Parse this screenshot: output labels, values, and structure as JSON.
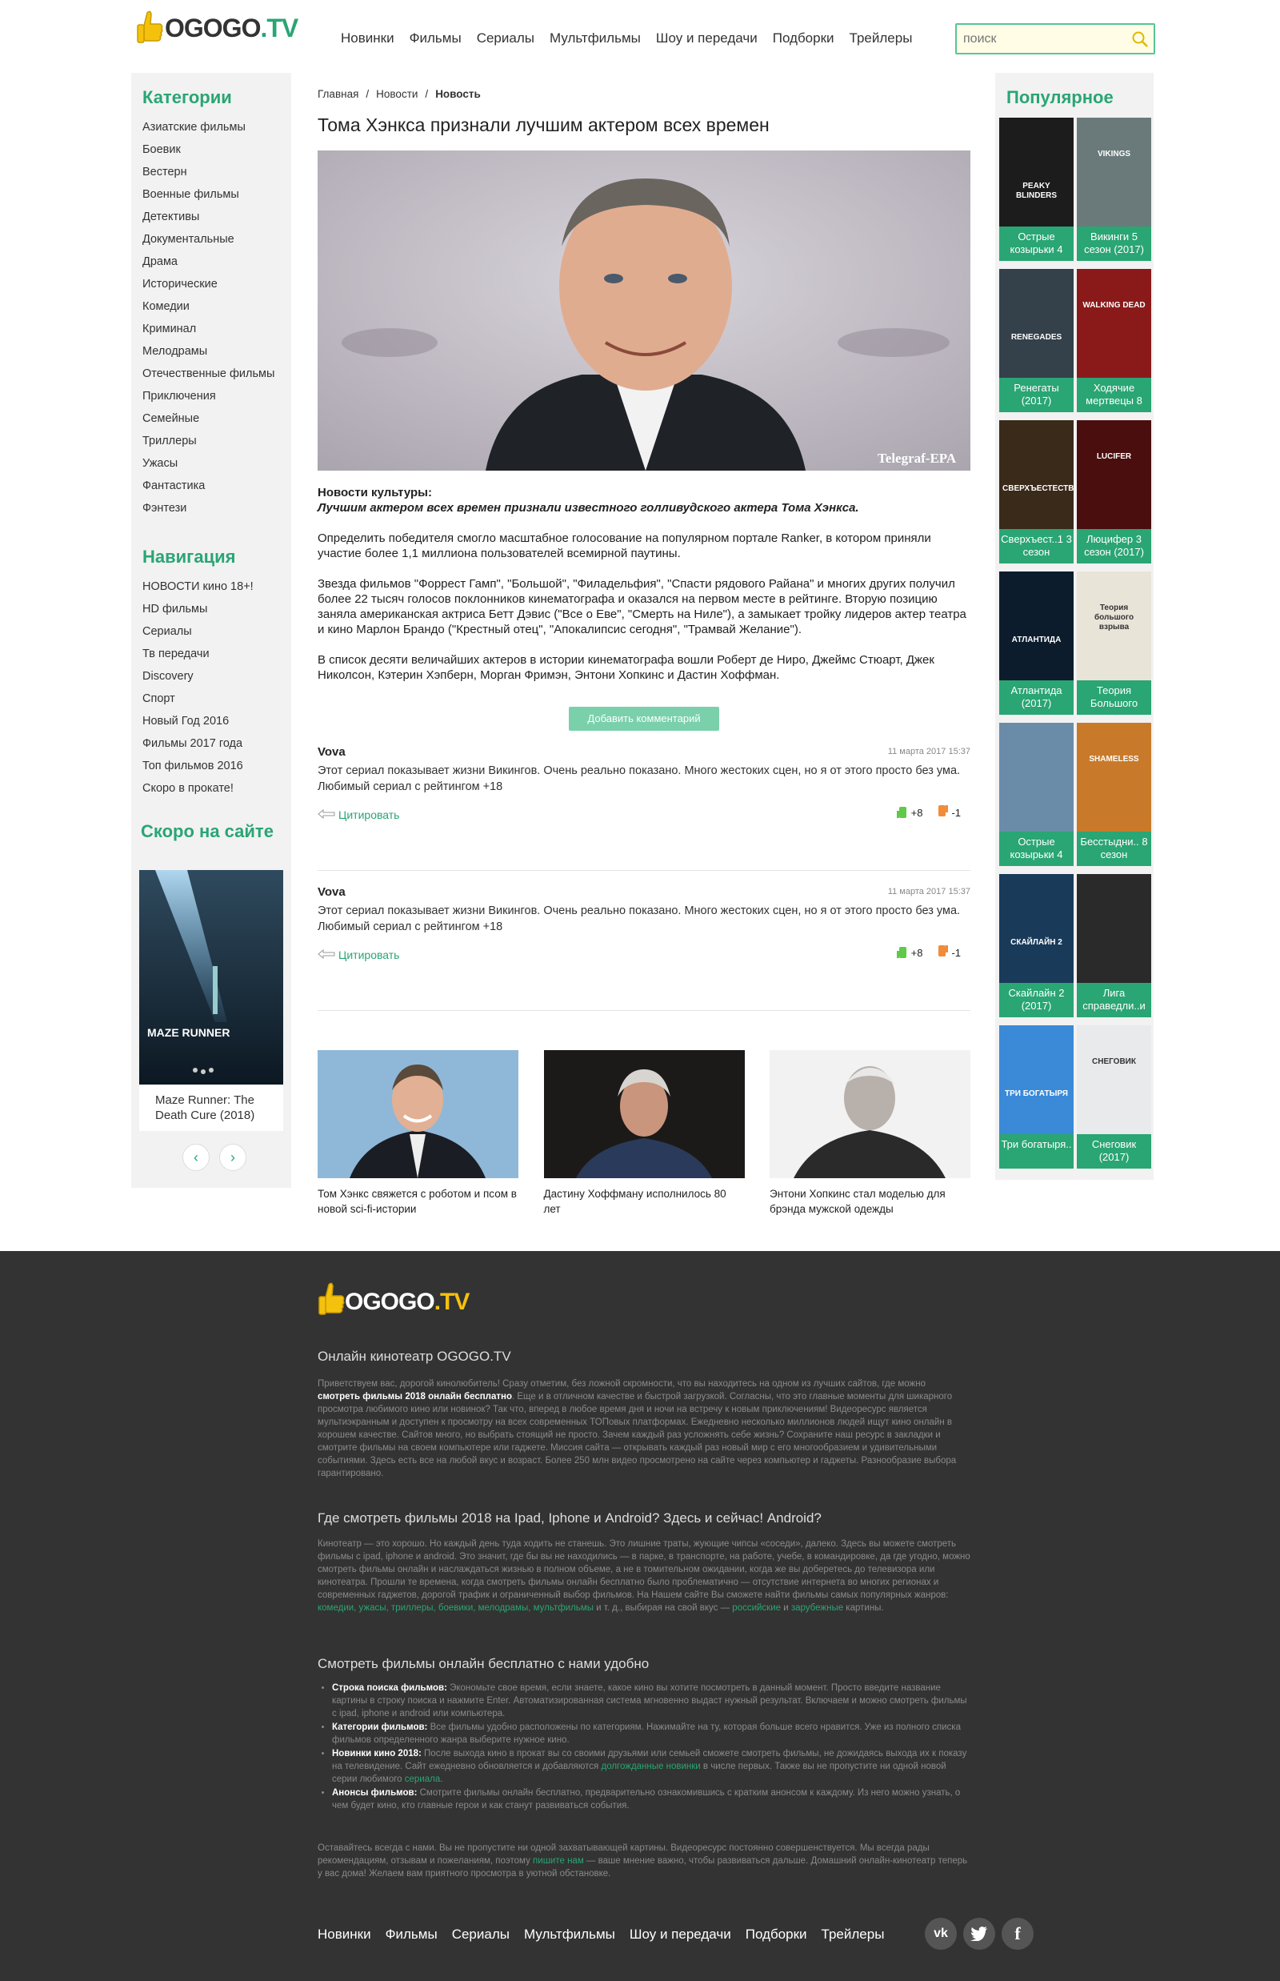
{
  "brand": {
    "logo_main": "OGOGO",
    "logo_tld": ".TV"
  },
  "topnav": [
    "Новинки",
    "Фильмы",
    "Сериалы",
    "Мультфильмы",
    "Шоу и передачи",
    "Подборки",
    "Трейлеры"
  ],
  "search": {
    "placeholder": "поиск"
  },
  "categories": {
    "title": "Категории",
    "items": [
      "Азиатские фильмы",
      "Боевик",
      "Вестерн",
      "Военные фильмы",
      "Детективы",
      "Документальные",
      "Драма",
      "Исторические",
      "Комедии",
      "Криминал",
      "Мелодрамы",
      "Отечественные фильмы",
      "Приключения",
      "Семейные",
      "Триллеры",
      "Ужасы",
      "Фантастика",
      "Фэнтези"
    ]
  },
  "navigation": {
    "title": "Навигация",
    "items": [
      "НОВОСТИ кино 18+!",
      "HD фильмы",
      "Сериалы",
      "Тв передачи",
      "Discovery",
      "Спорт",
      "Новый Год 2016",
      "Фильмы 2017 года",
      "Топ фильмов 2016",
      "Скоро в прокате!"
    ]
  },
  "soon": {
    "title": "Скоро на сайте",
    "caption": "Maze Runner: The Death Cure (2018)",
    "poster_text": "MAZE RUNNER"
  },
  "breadcrumbs": {
    "home": "Главная",
    "news": "Новости",
    "current": "Новость",
    "sep": "/"
  },
  "article": {
    "title": "Тома Хэнкса признали лучшим актером всех времен",
    "image_credit": "Telegraf-EPA",
    "lead_label": "Новости культуры:",
    "lead": "Лучшим актером всех времен признали известного голливудского актера Тома Хэнкса.",
    "p1": "Определить победителя смогло масштабное голосование на популярном портале Ranker, в котором приняли участие более 1,1 миллиона пользователей всемирной паутины.",
    "p2": "Звезда фильмов \"Форрест Гамп\", \"Большой\", \"Филадельфия\", \"Спасти рядового Райана\" и многих других получил более 22 тысяч голосов поклонников кинематографа и оказался на первом месте в рейтинге. Вторую позицию заняла американская актриса Бетт Дэвис (\"Все о Еве\", \"Смерть на Ниле\"), а замыкает тройку лидеров актер театра и кино Марлон Брандо (\"Крестный отец\", \"Апокалипсис сегодня\", \"Трамвай Желание\").",
    "p3": "В список десяти величайших актеров в истории кинематографа вошли Роберт де Ниро, Джеймс Стюарт, Джек Николсон, Кэтерин Хэпберн, Морган Фримэн, Энтони Хопкинс и Дастин Хоффман.",
    "add_comment": "Добавить комментарий"
  },
  "comments": [
    {
      "author": "Vova",
      "date": "11 марта 2017 15:37",
      "text": "Этот сериал показывает жизни Викингов. Очень реально показано. Много жестоких сцен, но я от этого просто без ума. Любимый сериал с рейтингом +18",
      "quote": "Цитировать",
      "up": "+8",
      "down": "-1"
    },
    {
      "author": "Vova",
      "date": "11 марта 2017 15:37",
      "text": "Этот сериал показывает жизни Викингов. Очень реально показано. Много жестоких сцен, но я от этого просто без ума. Любимый сериал с рейтингом +18",
      "quote": "Цитировать",
      "up": "+8",
      "down": "-1"
    }
  ],
  "related": [
    {
      "caption": "Том Хэнкс свяжется с роботом и псом в новой sci-fi-истории"
    },
    {
      "caption": "Дастину Хоффману исполнилось 80 лет"
    },
    {
      "caption": "Энтони Хопкинс стал моделью для брэнда мужской одежды"
    }
  ],
  "popular": {
    "title": "Популярное",
    "items": [
      {
        "caption": "Острые козырьки 4",
        "poster": "PEAKY BLINDERS",
        "bg": "#1c1c1c"
      },
      {
        "caption": "Викинги 5 сезон (2017)",
        "poster": "VIKINGS",
        "bg": "#6a7a7a"
      },
      {
        "caption": "Ренегаты (2017)",
        "poster": "RENEGADES",
        "bg": "#34404a"
      },
      {
        "caption": "Ходячие мертвецы 8",
        "poster": "WALKING DEAD",
        "bg": "#8a1a1a"
      },
      {
        "caption": "Сверхъест..1 3 сезон",
        "poster": "СВЕРХЪЕСТЕСТВЕННОЕ",
        "bg": "#3a2a1a"
      },
      {
        "caption": "Люцифер 3 сезон (2017)",
        "poster": "LUCIFER",
        "bg": "#4a0e0e"
      },
      {
        "caption": "Атлантида (2017)",
        "poster": "АТЛАНТИДА",
        "bg": "#0c1c2c"
      },
      {
        "caption": "Теория Большого",
        "poster": "Теория большого взрыва",
        "bg": "#e8e4d8"
      },
      {
        "caption": "Острые козырьки 4",
        "poster": "",
        "bg": "#6a8ca8"
      },
      {
        "caption": "Бесстыдни.. 8 сезон",
        "poster": "SHAMELESS",
        "bg": "#c87a2a"
      },
      {
        "caption": "Скайлайн 2 (2017)",
        "poster": "СКАЙЛАЙН 2",
        "bg": "#1a3a5a"
      },
      {
        "caption": "Лига справедли..и",
        "poster": "",
        "bg": "#2a2a2a"
      },
      {
        "caption": "Три богатыря..",
        "poster": "ТРИ БОГАТЫРЯ",
        "bg": "#3a8ad8"
      },
      {
        "caption": "Снеговик (2017)",
        "poster": "СНЕГОВИК",
        "bg": "#e8eaec"
      }
    ]
  },
  "footer": {
    "h1": "Онлайн кинотеатр OGOGO.TV",
    "p1a": "Приветствуем вас, дорогой кинолюбитель! Сразу отметим, без ложной скромности, что вы находитесь на одном из лучших сайтов, где можно ",
    "p1b": "смотреть фильмы 2018 онлайн бесплатно",
    "p1c": ". Еще и в отличном качестве и быстрой загрузкой. Согласны, что это главные моменты для шикарного просмотра любимого кино или новинок? Так что, вперед в любое время дня и ночи на встречу к новым приключениям! Видеоресурс является мультиэкранным и доступен к просмотру на всех современных ТОПовых платформах. Ежедневно несколько миллионов людей ищут кино онлайн в хорошем качестве. Сайтов много, но выбрать стоящий не просто. Зачем каждый раз усложнять себе жизнь? Сохраните наш ресурс в закладки и смотрите фильмы на своем компьютере или гаджете. Миссия сайта — открывать каждый раз новый мир с его многообразием и удивительными событиями. Здесь есть все на любой вкус и возраст. Более 250 млн видео просмотрено на сайте через компьютер и гаджеты. Разнообразие выбора гарантировано.",
    "h2": "Где смотреть фильмы 2018 на Ipad, Iphone и Android? Здесь и сейчас! Android?",
    "p2a": "Кинотеатр — это хорошо. Но каждый день туда ходить не станешь. Это лишние траты, жующие чипсы «соседи», далеко. Здесь вы можете смотреть фильмы с ipad, iphone и android. Это значит, где бы вы не находились — в парке, в транспорте, на работе, учебе, в командировке, да где угодно, можно смотреть фильмы онлайн и наслаждаться жизнью в полном объеме, а не в томительном ожидании, когда же вы доберетесь до телевизора или кинотеатра. Прошли те времена, когда смотреть фильмы онлайн бесплатно было проблематично — отсутствие интернета во многих регионах и современных гаджетов, дорогой трафик и ограниченный выбор фильмов. На Нашем сайте Вы сможете найти фильмы самых популярных жанров: ",
    "genres": "комедии, ужасы, триллеры, боевики, мелодрамы, мультфильмы",
    "p2b": " и т. д., выбирая на свой вкус — ",
    "p2c": "российские",
    "p2d": " и ",
    "p2e": "зарубежные",
    "p2f": " картины.",
    "h3": "Смотреть фильмы онлайн бесплатно с нами удобно",
    "li1b": "Строка поиска фильмов:",
    "li1": " Экономьте свое время, если знаете, какое кино вы хотите посмотреть в данный момент. Просто введите название картины в строку поиска и нажмите Enter. Автоматизированная система мгновенно выдаст нужный результат. Включаем и можно смотреть фильмы с ipad, iphone и android или компьютера.",
    "li2b": "Категории фильмов:",
    "li2": " Все фильмы удобно расположены по категориям. Нажимайте на ту, которая больше всего нравится. Уже из полного списка фильмов определенного жанра выберите нужное кино.",
    "li3b": "Новинки кино 2018:",
    "li3a": " После выхода кино в прокат вы со своими друзьями или семьей сможете смотреть фильмы, не дожидаясь выхода их к показу на телевидение. Сайт ежедневно обновляется и добавляются ",
    "li3g": "долгожданные новинки",
    "li3c": " в числе первых. Также вы не пропустите ни одной новой серии любимого ",
    "li3g2": "сериала",
    "li3d": ".",
    "li4b": "Анонсы фильмов:",
    "li4": " Смотрите фильмы онлайн бесплатно, предварительно ознакомившись с кратким анонсом к каждому. Из него можно узнать, о чем будет кино, кто главные герои и как станут развиваться события.",
    "p4a": "Оставайтесь всегда с нами. Вы не пропустите ни одной захватывающей картины. Видеоресурс постоянно совершенствуется. Мы всегда рады рекомендациям, отзывам и пожеланиям, поэтому ",
    "p4g": "пишите нам",
    "p4b": " — ваше мнение важно, чтобы развиваться дальше. Домашний онлайн-кинотеатр теперь у вас дома! Желаем вам приятного просмотра в уютной обстановке.",
    "nav": [
      "Новинки",
      "Фильмы",
      "Сериалы",
      "Мультфильмы",
      "Шоу и передачи",
      "Подборки",
      "Трейлеры"
    ],
    "social": [
      "vk",
      "twitter",
      "facebook"
    ]
  },
  "colors": {
    "accent": "#2aa574",
    "button": "#7ad0ab",
    "footer_bg": "#333333"
  }
}
